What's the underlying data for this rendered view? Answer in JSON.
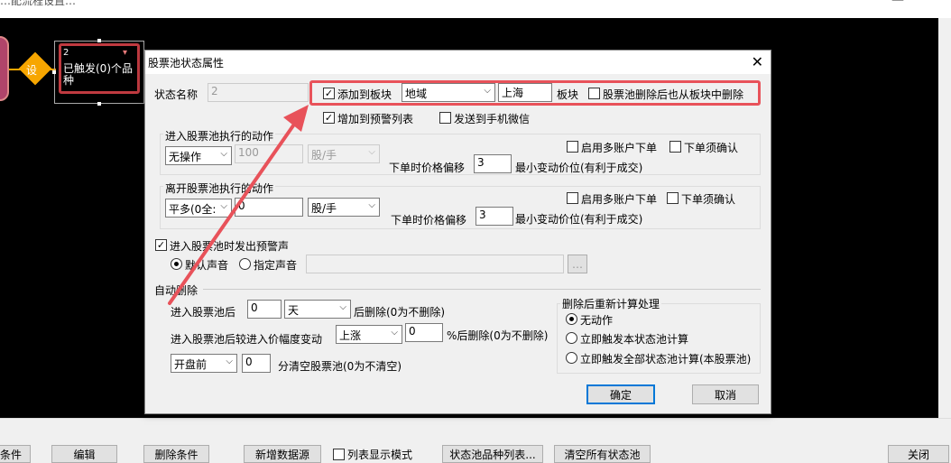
{
  "window": {
    "title_partial": "…配流程设置…",
    "min_glyph": "—"
  },
  "flow_node": {
    "id": "2",
    "text": "已触发(0)个品种",
    "diamond_label": "设"
  },
  "dialog": {
    "title": "股票池状态属性",
    "close": "✕",
    "state_name_label": "状态名称",
    "state_name_value": "2",
    "add_to_block": {
      "label": "添加到板块",
      "checked": true
    },
    "block_type": "地域",
    "block_name": "上海",
    "block_suffix": "板块",
    "remove_from_block": {
      "label": "股票池删除后也从板块中删除",
      "checked": false
    },
    "add_to_warning": {
      "label": "增加到预警列表",
      "checked": true
    },
    "send_wechat": {
      "label": "发送到手机微信",
      "checked": false
    },
    "enter_action": {
      "title": "进入股票池执行的动作",
      "action": "无操作",
      "qty": "100",
      "unit": "股/手",
      "multi_account": "启用多账户下单",
      "must_confirm": "下单须确认",
      "offset_label": "下单时价格偏移",
      "offset": "3",
      "offset_unit": "最小变动价位(有利于成交)"
    },
    "leave_action": {
      "title": "离开股票池执行的动作",
      "action": "平多(0全:",
      "qty": "0",
      "unit": "股/手",
      "multi_account": "启用多账户下单",
      "must_confirm": "下单须确认",
      "offset_label": "下单时价格偏移",
      "offset": "3",
      "offset_unit": "最小变动价位(有利于成交)"
    },
    "sound": {
      "label": "进入股票池时发出预警声",
      "default": "默认声音",
      "custom": "指定声音",
      "browse": "…"
    },
    "auto_delete": {
      "title": "自动删除",
      "after_label": "进入股票池后",
      "after_value": "0",
      "after_unit": "天",
      "after_suffix": "后删除(0为不删除)",
      "change_label": "进入股票池后较进入价幅度变动",
      "change_dir": "上涨",
      "change_value": "0",
      "change_suffix": "%后删除(0为不删除)",
      "clear_when": "开盘前",
      "clear_value": "0",
      "clear_suffix": "分清空股票池(0为不清空)"
    },
    "recalc": {
      "title": "删除后重新计算处理",
      "none": "无动作",
      "this": "立即触发本状态池计算",
      "all": "立即触发全部状态池计算(本股票池)"
    },
    "ok": "确定",
    "cancel": "取消"
  },
  "bottom_buttons": [
    "条件",
    "编辑",
    "删除条件",
    "新增数据源",
    "列表显示模式",
    "状态池品种列表...",
    "清空所有状态池",
    "关闭"
  ],
  "colors": {
    "highlight": "#e8525a",
    "canvas": "#000000",
    "node_border": "#c03a40",
    "accent": "#f7a600"
  }
}
